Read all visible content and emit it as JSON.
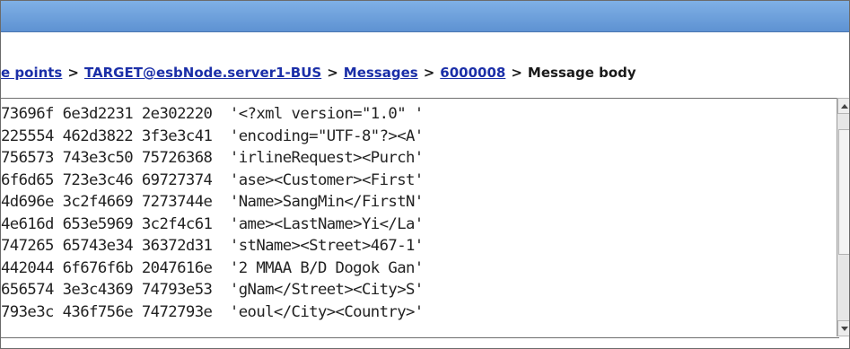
{
  "breadcrumb": {
    "items": [
      {
        "label": "e points",
        "link": true
      },
      {
        "label": "TARGET@esbNode.server1-BUS",
        "link": true
      },
      {
        "label": "Messages",
        "link": true
      },
      {
        "label": "6000008",
        "link": true
      },
      {
        "label": "Message body",
        "link": false
      }
    ],
    "separator": ">"
  },
  "message_body": {
    "rows": [
      "73696f 6e3d2231 2e302220  '<?xml version=\"1.0\" '",
      "225554 462d3822 3f3e3c41  'encoding=\"UTF-8\"?><A'",
      "756573 743e3c50 75726368  'irlineRequest><Purch'",
      "6f6d65 723e3c46 69727374  'ase><Customer><First'",
      "4d696e 3c2f4669 7273744e  'Name>SangMin</FirstN'",
      "4e616d 653e5969 3c2f4c61  'ame><LastName>Yi</La'",
      "747265 65743e34 36372d31  'stName><Street>467-1'",
      "442044 6f676f6b 2047616e  '2 MMAA B/D Dogok Gan'",
      "656574 3e3c4369 74793e53  'gNam</Street><City>S'",
      "793e3c 436f756e 7472793e  'eoul</City><Country>'"
    ]
  },
  "colors": {
    "titlebar": "#6a9fde",
    "link": "#1b2fa8",
    "text": "#222222"
  }
}
